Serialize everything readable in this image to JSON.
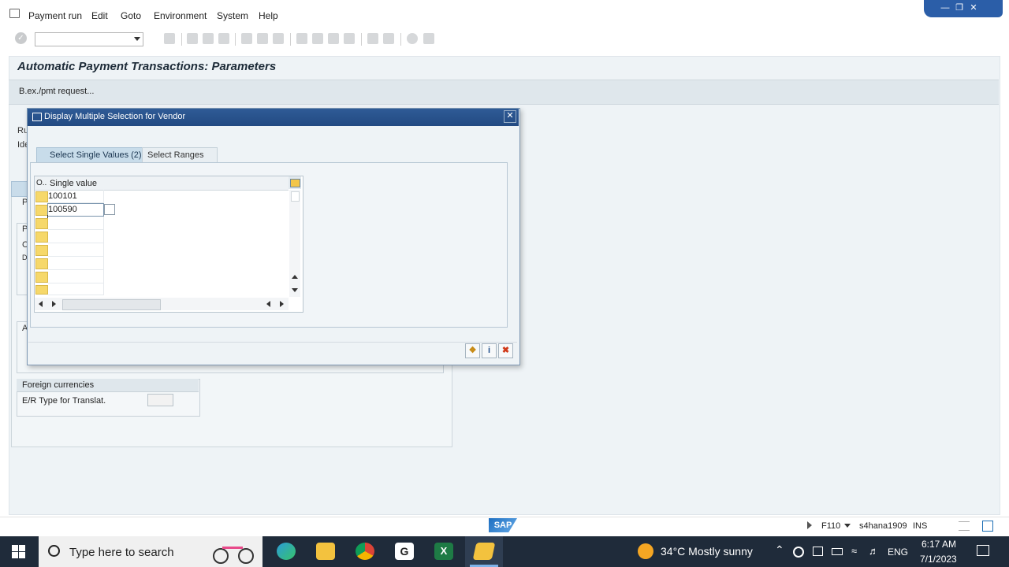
{
  "menu": {
    "items": [
      "Payment run",
      "Edit",
      "Goto",
      "Environment",
      "System",
      "Help"
    ]
  },
  "main": {
    "title": "Automatic Payment Transactions: Parameters",
    "app_button": "B.ex./pmt request...",
    "cut_labels": [
      "Ru",
      "Ide",
      "P",
      "P",
      "C",
      "D",
      "A"
    ],
    "foreign_currencies": {
      "title": "Foreign currencies",
      "label": "E/R Type for Translat."
    }
  },
  "dialog": {
    "title": "Display Multiple Selection for Vendor",
    "tabs": [
      {
        "label": "Select Single Values (2)",
        "active": true
      },
      {
        "label": "Select Ranges",
        "active": false
      }
    ],
    "table": {
      "col_option": "O..",
      "col_value": "Single value",
      "rows": [
        "100101",
        "100590",
        "",
        "",
        "",
        "",
        "",
        ""
      ]
    },
    "footer_buttons": [
      "copy-icon",
      "info-icon",
      "cancel-icon"
    ]
  },
  "statusbar": {
    "transaction": "F110",
    "system": "s4hana1909",
    "mode": "INS",
    "logo": "SAP"
  },
  "taskbar": {
    "search_placeholder": "Type here to search",
    "weather": "34°C  Mostly sunny",
    "language": "ENG",
    "time": "6:17 AM",
    "date": "7/1/2023"
  },
  "colors": {
    "dialog_header": "#224a82",
    "tab_active": "#c8dcea",
    "row_selector": "#f6d86a",
    "taskbar": "#1f2b3a"
  }
}
